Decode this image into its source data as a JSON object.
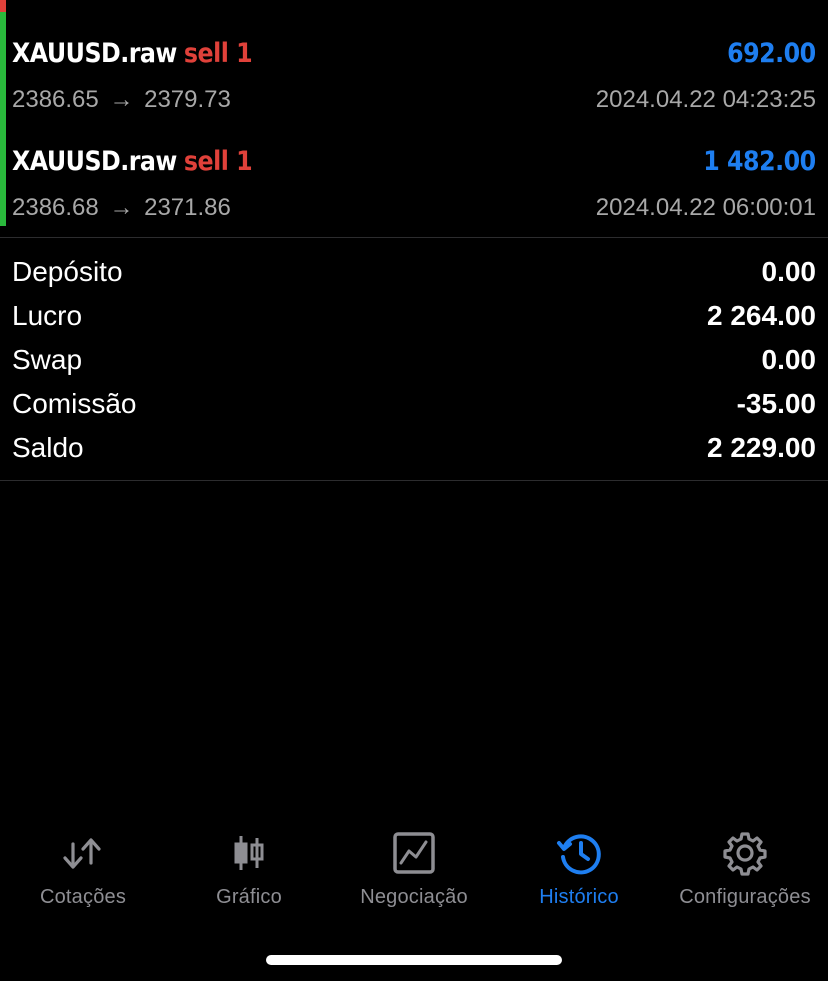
{
  "trades": [
    {
      "symbol": "XAUUSD.raw",
      "side_volume": "sell 1",
      "profit": "692.00",
      "open_price": "2386.65",
      "arrow": "→",
      "close_price": "2379.73",
      "time": "2024.04.22 04:23:25"
    },
    {
      "symbol": "XAUUSD.raw",
      "side_volume": "sell 1",
      "profit": "1 482.00",
      "open_price": "2386.68",
      "arrow": "→",
      "close_price": "2371.86",
      "time": "2024.04.22 06:00:01"
    }
  ],
  "summary": [
    {
      "label": "Depósito",
      "value": "0.00"
    },
    {
      "label": "Lucro",
      "value": "2 264.00"
    },
    {
      "label": "Swap",
      "value": "0.00"
    },
    {
      "label": "Comissão",
      "value": "-35.00"
    },
    {
      "label": "Saldo",
      "value": "2 229.00"
    }
  ],
  "tabs": [
    {
      "label": "Cotações",
      "icon": "quotes-arrows-icon",
      "active": false
    },
    {
      "label": "Gráfico",
      "icon": "candlestick-chart-icon",
      "active": false
    },
    {
      "label": "Negociação",
      "icon": "trade-chart-icon",
      "active": false
    },
    {
      "label": "Histórico",
      "icon": "history-clock-icon",
      "active": true
    },
    {
      "label": "Configurações",
      "icon": "gear-icon",
      "active": false
    }
  ],
  "colors": {
    "background": "#000000",
    "sell": "#e0413a",
    "profit": "#1e7ef0",
    "secondary_text": "#a8a8a8",
    "inactive_tab": "#8e8e93",
    "active_tab": "#1e7ef0",
    "position_bar": "#2ab93c"
  }
}
